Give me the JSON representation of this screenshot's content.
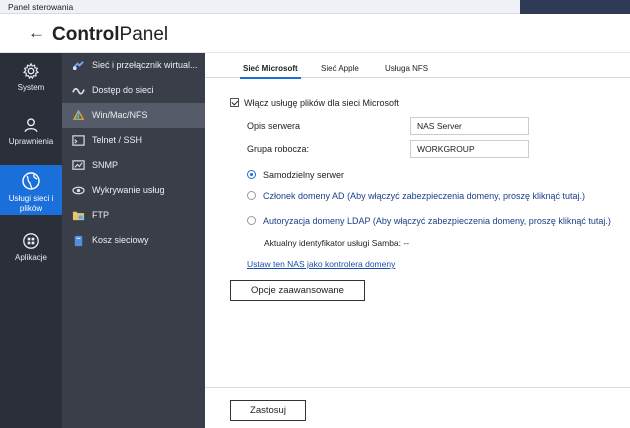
{
  "window": {
    "title": "Panel sterowania"
  },
  "header": {
    "back_icon": "arrow-left-icon",
    "title_bold": "Control",
    "title_rest": "Panel"
  },
  "rail": {
    "items": [
      {
        "label": "System",
        "icon": "gear-icon"
      },
      {
        "label": "Uprawnienia",
        "icon": "user-icon"
      },
      {
        "label": "Usługi sieci i plików",
        "icon": "globe-icon"
      },
      {
        "label": "Aplikacje",
        "icon": "grid-icon"
      }
    ]
  },
  "subnav": {
    "items": [
      {
        "label": "Sieć i przełącznik wirtual...",
        "icon": "network-icon"
      },
      {
        "label": "Dostęp do sieci",
        "icon": "wave-icon"
      },
      {
        "label": "Win/Mac/NFS",
        "icon": "os-icon"
      },
      {
        "label": "Telnet / SSH",
        "icon": "terminal-icon"
      },
      {
        "label": "SNMP",
        "icon": "snmp-icon"
      },
      {
        "label": "Wykrywanie usług",
        "icon": "discovery-icon"
      },
      {
        "label": "FTP",
        "icon": "ftp-icon"
      },
      {
        "label": "Kosz sieciowy",
        "icon": "trash-icon"
      }
    ]
  },
  "tabs": [
    "Sieć Microsoft",
    "Sieć Apple",
    "Usługa NFS"
  ],
  "form": {
    "enable_label": "Włącz usługę plików dla sieci Microsoft",
    "server_desc_label": "Opis serwera",
    "server_desc_value": "NAS Server",
    "workgroup_label": "Grupa robocza:",
    "workgroup_value": "WORKGROUP",
    "radio_standalone": "Samodzielny serwer",
    "radio_ad": "Członek domeny AD",
    "radio_ad_hint": "(Aby włączyć zabezpieczenia domeny, proszę kliknąć tutaj.)",
    "radio_ldap": "Autoryzacja domeny LDAP",
    "radio_ldap_hint": "(Aby włączyć zabezpieczenia domeny, proszę kliknąć tutaj.)",
    "samba_id": "Aktualny identyfikator usługi Samba: --",
    "dc_link": "Ustaw ten NAS jako kontrolera domeny",
    "advanced_button": "Opcje zaawansowane",
    "apply_button": "Zastosuj"
  },
  "colors": {
    "accent": "#1b6fdb",
    "rail_bg": "#2b2f3a",
    "subnav_bg": "#3a3e49",
    "subnav_active": "#555b69"
  }
}
